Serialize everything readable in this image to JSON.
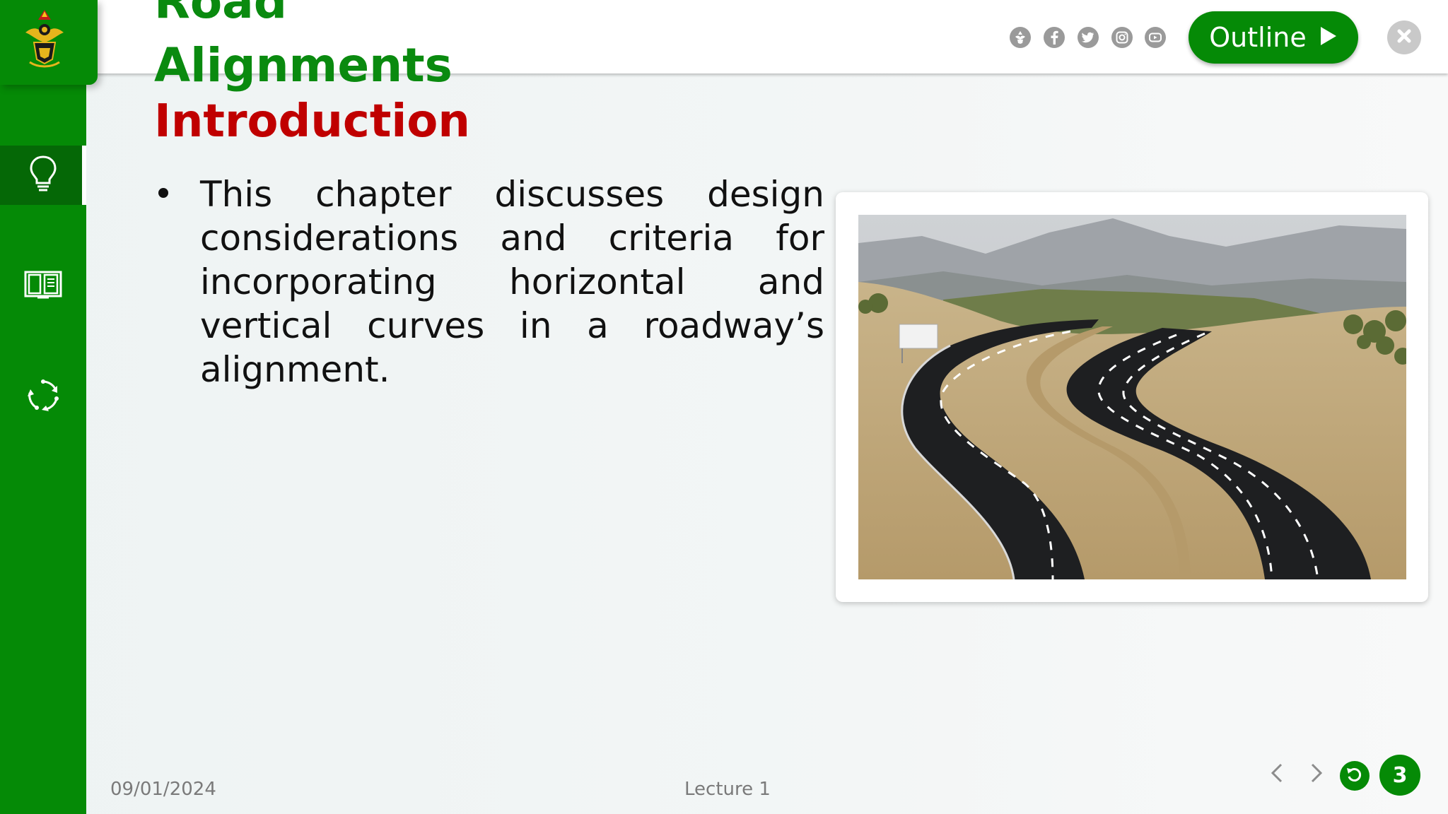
{
  "title": {
    "line1": "Road",
    "line2": "Alignments",
    "section": "Introduction"
  },
  "sidebar": {
    "items": [
      {
        "icon": "lightbulb-icon",
        "active": true
      },
      {
        "icon": "book-icon",
        "active": false
      },
      {
        "icon": "cycle-icon",
        "active": false
      }
    ]
  },
  "topbar": {
    "social_icons": [
      "university-logo-icon",
      "facebook-icon",
      "twitter-icon",
      "instagram-icon",
      "youtube-icon"
    ],
    "outline_label": "Outline"
  },
  "content": {
    "bullet": "This chapter discusses design considerations and criteria for incorporating horizontal and vertical curves in a roadway’s alignment."
  },
  "footer": {
    "date": "09/01/2024",
    "lecture": "Lecture 1",
    "page_number": "3"
  },
  "colors": {
    "brand_green": "#058a06",
    "title_green": "#0a8a0f",
    "section_red": "#c00000"
  }
}
